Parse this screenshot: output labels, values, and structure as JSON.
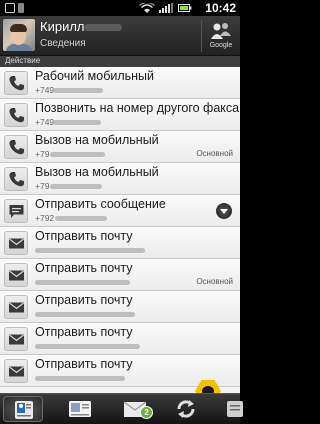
{
  "status_bar": {
    "time": "10:42"
  },
  "contact": {
    "name": "Кирилл",
    "subtitle": "Сведения",
    "source_label": "Google"
  },
  "section_title": "Действие",
  "actions": [
    {
      "title": "Рабочий мобильный",
      "sub": "+749",
      "tag": "",
      "icon": "phone-icon"
    },
    {
      "title": "Позвонить на номер другого факса",
      "sub": "+749",
      "tag": "",
      "icon": "phone-icon"
    },
    {
      "title": "Вызов на мобильный",
      "sub": "+79",
      "tag": "Основной",
      "icon": "phone-icon"
    },
    {
      "title": "Вызов на мобильный",
      "sub": "+79",
      "tag": "",
      "icon": "phone-icon"
    },
    {
      "title": "Отправить сообщение",
      "sub": "+792",
      "tag": "",
      "icon": "message-icon"
    },
    {
      "title": "Отправить почту",
      "sub": "",
      "tag": "",
      "icon": "mail-icon"
    },
    {
      "title": "Отправить почту",
      "sub": "",
      "tag": "Основной",
      "icon": "mail-icon"
    },
    {
      "title": "Отправить почту",
      "sub": "",
      "tag": "",
      "icon": "mail-icon"
    },
    {
      "title": "Отправить почту",
      "sub": "",
      "tag": "",
      "icon": "mail-icon"
    },
    {
      "title": "Отправить почту",
      "sub": "",
      "tag": "",
      "icon": "mail-icon"
    }
  ],
  "dock": {
    "mail_badge": "2"
  }
}
